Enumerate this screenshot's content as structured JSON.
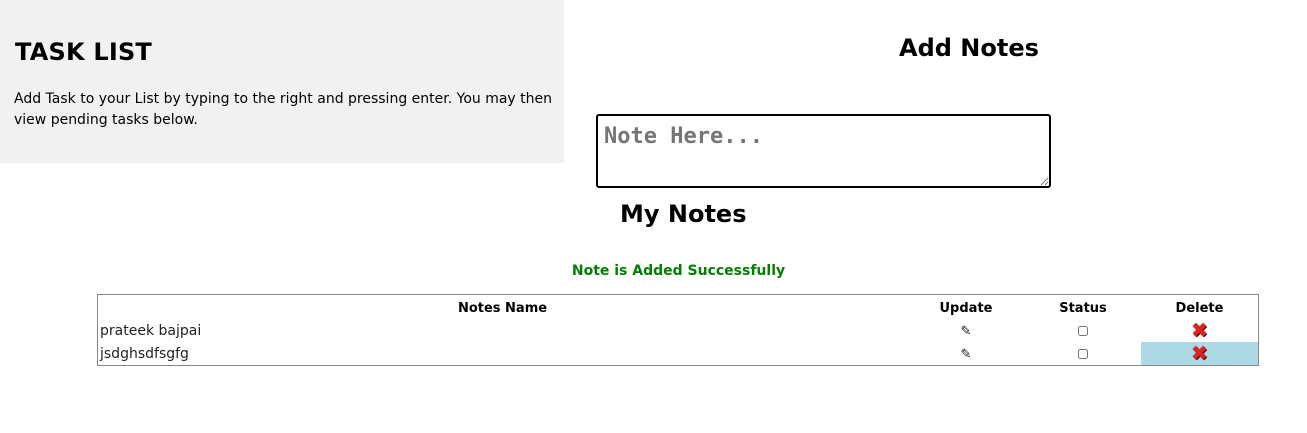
{
  "info": {
    "title": "TASK LIST",
    "text": "Add Task to your List by typing to the right and pressing enter. You may then view pending tasks below."
  },
  "add": {
    "title": "Add Notes",
    "placeholder": "Note Here..."
  },
  "notes": {
    "title": "My Notes",
    "status_message": "Note is Added Successfully",
    "status_color": "#008000",
    "columns": {
      "name": "Notes Name",
      "update": "Update",
      "status": "Status",
      "delete": "Delete"
    },
    "rows": [
      {
        "name": "prateek bajpai",
        "update_icon": "pencil-icon",
        "status_checked": false,
        "delete_icon": "delete-x-icon"
      },
      {
        "name": "jsdghsdfsgfg",
        "update_icon": "pencil-icon",
        "status_checked": false,
        "delete_icon": "delete-x-icon"
      }
    ],
    "highlight_color": "#add8e6",
    "delete_color": "#d9231f"
  }
}
